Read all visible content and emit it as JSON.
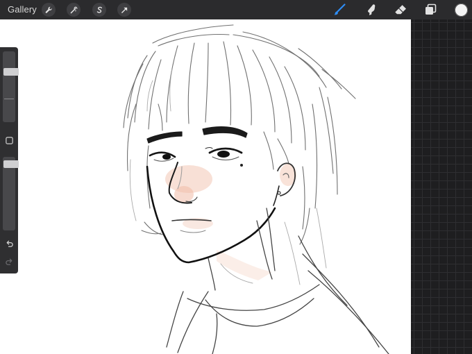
{
  "topbar": {
    "gallery_label": "Gallery",
    "left_tools": [
      "wrench-icon",
      "magic-wand-icon",
      "selection-icon",
      "transform-arrow-icon"
    ],
    "right_tools": [
      "brush-icon",
      "smudge-icon",
      "eraser-icon",
      "layers-icon"
    ],
    "active_tool": "brush-icon",
    "accent_color": "#2e8df5",
    "current_color": "#f4f4f4"
  },
  "sidebar": {
    "brush_size_level": 0.26,
    "opacity_level": 0.05,
    "controls": [
      "modify-square-icon",
      "undo-icon",
      "redo-icon"
    ]
  },
  "colors": {
    "toolbar_bg": "#2b2b2d",
    "canvas_bg": "#ffffff",
    "workspace_bg": "#1e1e20",
    "skin_tint": "#f3c7b4"
  }
}
